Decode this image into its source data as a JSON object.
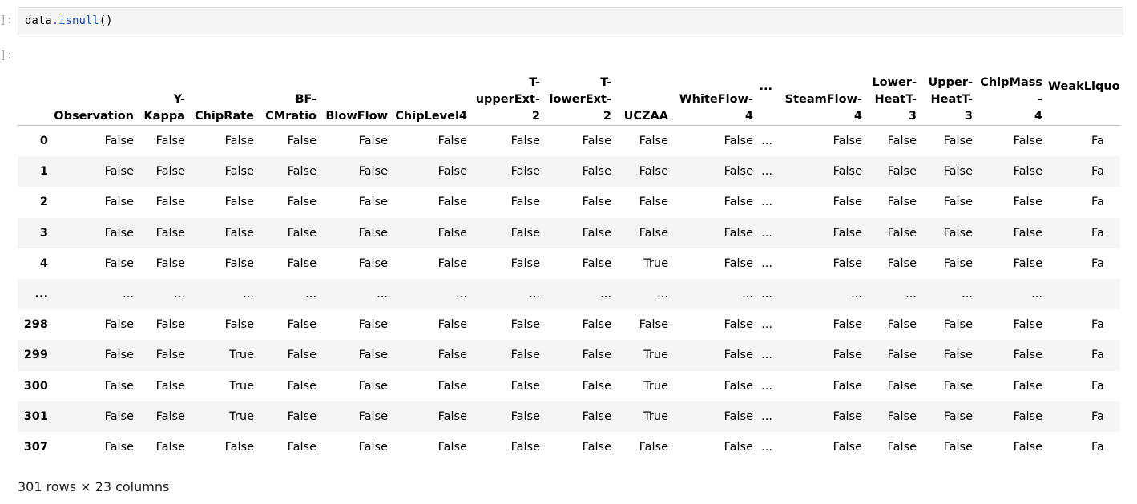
{
  "input": {
    "prompt": "]:",
    "code_var": "data",
    "code_op": ".",
    "code_fn": "isnull",
    "code_paren": "()"
  },
  "output": {
    "prompt": "]:",
    "columns": [
      "",
      "Observation",
      "Y-\nKappa",
      "ChipRate",
      "BF-\nCMratio",
      "BlowFlow",
      "ChipLevel4",
      "T-\nupperExt-\n2",
      "T-\nlowerExt-\n2",
      "UCZAA",
      "WhiteFlow-\n4",
      "...",
      "SteamFlow-\n4",
      "Lower-\nHeatT-\n3",
      "Upper-\nHeatT-\n3",
      "ChipMass-\n4",
      "WeakLiquo"
    ],
    "rows": [
      [
        "0",
        "False",
        "False",
        "False",
        "False",
        "False",
        "False",
        "False",
        "False",
        "False",
        "False",
        "...",
        "False",
        "False",
        "False",
        "False",
        "Fa"
      ],
      [
        "1",
        "False",
        "False",
        "False",
        "False",
        "False",
        "False",
        "False",
        "False",
        "False",
        "False",
        "...",
        "False",
        "False",
        "False",
        "False",
        "Fa"
      ],
      [
        "2",
        "False",
        "False",
        "False",
        "False",
        "False",
        "False",
        "False",
        "False",
        "False",
        "False",
        "...",
        "False",
        "False",
        "False",
        "False",
        "Fa"
      ],
      [
        "3",
        "False",
        "False",
        "False",
        "False",
        "False",
        "False",
        "False",
        "False",
        "False",
        "False",
        "...",
        "False",
        "False",
        "False",
        "False",
        "Fa"
      ],
      [
        "4",
        "False",
        "False",
        "False",
        "False",
        "False",
        "False",
        "False",
        "False",
        "True",
        "False",
        "...",
        "False",
        "False",
        "False",
        "False",
        "Fa"
      ],
      [
        "...",
        "...",
        "...",
        "...",
        "...",
        "...",
        "...",
        "...",
        "...",
        "...",
        "...",
        "...",
        "...",
        "...",
        "...",
        "...",
        ""
      ],
      [
        "298",
        "False",
        "False",
        "False",
        "False",
        "False",
        "False",
        "False",
        "False",
        "False",
        "False",
        "...",
        "False",
        "False",
        "False",
        "False",
        "Fa"
      ],
      [
        "299",
        "False",
        "False",
        "True",
        "False",
        "False",
        "False",
        "False",
        "False",
        "True",
        "False",
        "...",
        "False",
        "False",
        "False",
        "False",
        "Fa"
      ],
      [
        "300",
        "False",
        "False",
        "True",
        "False",
        "False",
        "False",
        "False",
        "False",
        "True",
        "False",
        "...",
        "False",
        "False",
        "False",
        "False",
        "Fa"
      ],
      [
        "301",
        "False",
        "False",
        "True",
        "False",
        "False",
        "False",
        "False",
        "False",
        "True",
        "False",
        "...",
        "False",
        "False",
        "False",
        "False",
        "Fa"
      ],
      [
        "307",
        "False",
        "False",
        "False",
        "False",
        "False",
        "False",
        "False",
        "False",
        "False",
        "False",
        "...",
        "False",
        "False",
        "False",
        "False",
        "Fa"
      ]
    ],
    "summary": "301 rows × 23 columns"
  }
}
